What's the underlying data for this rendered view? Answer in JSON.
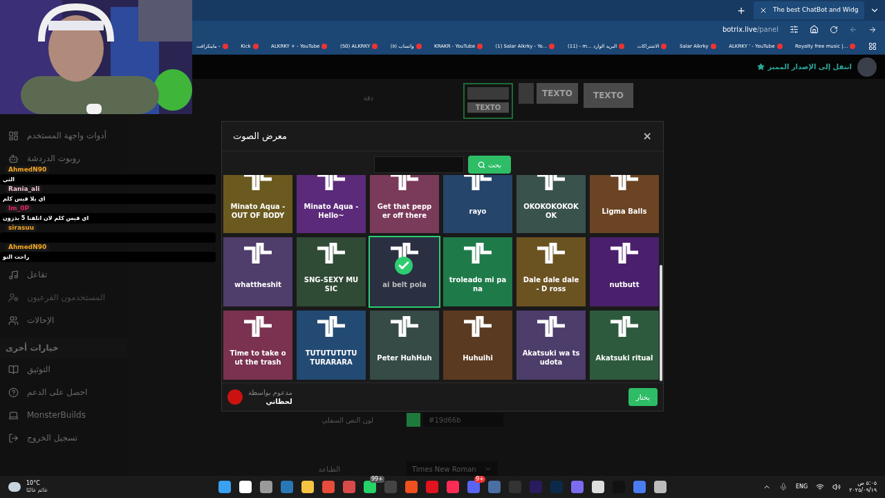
{
  "browser": {
    "tab_title": "The best ChatBot and Widg",
    "new_tab": "+",
    "url_host": "botrix.live",
    "url_path": "/panel",
    "bookmarks": [
      "Royalty free music |...",
      "ALKRKY ' - YouTube",
      "Salar Alkrky",
      "الاشتراكات",
      "(11) - m... البريد الوارد",
      "(1) Salar Alkrky - Yo...",
      "KRAKR - YouTube",
      "(٥) واتساب",
      "(50) ALKRKY",
      "ALKRKY + - YouTube",
      "Kick",
      "ماينكرافت -"
    ]
  },
  "header": {
    "upgrade_link": "انتقل إلى الإصدار المميز"
  },
  "sidebar": {
    "items_top": [
      "أدوات واجهة المستخدم",
      "روبوت الدردشة"
    ],
    "items_bottom": [
      "تفاعل",
      "المستخدمون الفرعيون",
      "الإحالات"
    ],
    "section": "خيارات أخرى",
    "items_other": [
      "التوثيق",
      "احصل على الدعم",
      "MonsterBuilds",
      "تسجيل الخروج"
    ]
  },
  "chat": [
    {
      "user": "AhmedN90",
      "color": "#f5a623",
      "message": "الثي"
    },
    {
      "user": "Rania_ali",
      "color": "#f2c4d4",
      "message": "اي يلا قيس كلم"
    },
    {
      "user": "Im_0P",
      "color": "#e0245e",
      "message": "اي قيس كلم لان اتلقنا 5 بذزون"
    },
    {
      "user": "sirasuu",
      "color": "#f5a623"
    },
    {
      "user": "AhmedN90",
      "color": "#f5a623",
      "message": "راحت التو"
    }
  ],
  "settings": {
    "resolution_label": "دقة",
    "thumb_texts": [
      "TEXTO",
      "TEXTO",
      "TEXTO"
    ],
    "bottom_color_label": "لون النص السفلي",
    "bottom_color_value": "#19d66b",
    "font_label": "الطباعة",
    "font_value": "Times New Roman"
  },
  "modal": {
    "title": "معرض الصوت",
    "close": "×",
    "search_button": "بحث",
    "select_button": "يختار",
    "sponsor_label": "مدعوم بواسطة",
    "sponsor_name": "لحظاتي",
    "sounds": [
      {
        "name": "Ligma Balls",
        "color": "#6b4423",
        "selected": false
      },
      {
        "name": "OKOKOKOKOKOK",
        "color": "#3a524c",
        "selected": false
      },
      {
        "name": "rayo",
        "color": "#25456b",
        "selected": false
      },
      {
        "name": "Get that pepper off there",
        "color": "#7a3a5a",
        "selected": false
      },
      {
        "name": "Minato Aqua - Hello~",
        "color": "#5b2a7a",
        "selected": false
      },
      {
        "name": "Minato Aqua - OUT OF BODY",
        "color": "#6b5a1f",
        "selected": false
      },
      {
        "name": "nutbutt",
        "color": "#4a1f6b",
        "selected": false
      },
      {
        "name": "Dale dale dale - D ross",
        "color": "#6b5221",
        "selected": false
      },
      {
        "name": "troleado mi pana",
        "color": "#1f7a4a",
        "selected": false
      },
      {
        "name": "ai belt pola",
        "color": "#2a2f42",
        "selected": true
      },
      {
        "name": "SNG-SEXY MUSIC",
        "color": "#2f4a35",
        "selected": false
      },
      {
        "name": "whattheshit",
        "color": "#4f3d6b",
        "selected": false
      },
      {
        "name": "Akatsuki ritual",
        "color": "#2d5a3d",
        "selected": false
      },
      {
        "name": "Akatsuki wa tsudota",
        "color": "#4d3d6b",
        "selected": false
      },
      {
        "name": "Huhuihi",
        "color": "#5a3a20",
        "selected": false
      },
      {
        "name": "Peter HuhHuh",
        "color": "#364a46",
        "selected": false
      },
      {
        "name": "TUTUTUTUTU TURARARA",
        "color": "#224a73",
        "selected": false
      },
      {
        "name": "Time to take out the trash",
        "color": "#7a3250",
        "selected": false
      }
    ]
  },
  "taskbar": {
    "temperature": "10°C",
    "weather": "غائم غالبًا",
    "whatsapp_badge": "99+",
    "discord_badge": "9+",
    "language": "ENG",
    "time": "٥:٠٥ ص",
    "date": "٢٠٢٥/٠٩/١٩"
  }
}
